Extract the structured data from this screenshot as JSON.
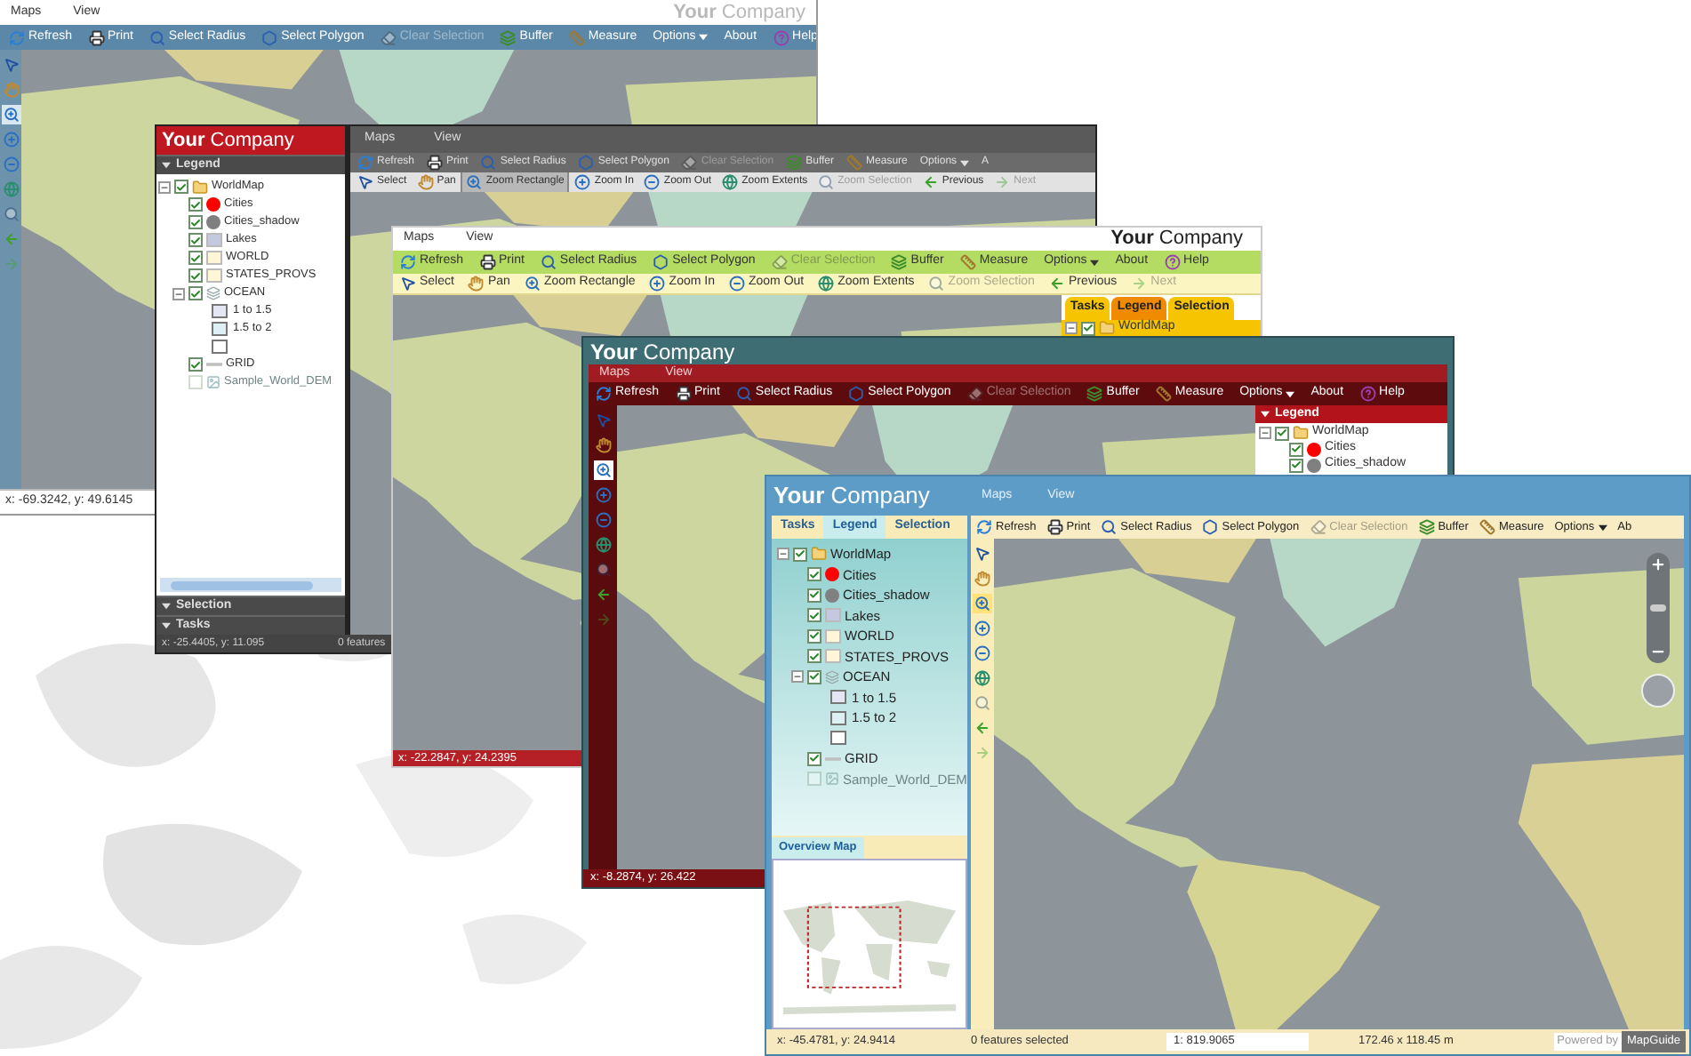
{
  "windows": [
    {
      "kind": "steel",
      "logo": "**Your** Company",
      "menu": [
        "Maps",
        "View"
      ],
      "toolbar": [
        {
          "kind": "refresh",
          "label": "Refresh",
          "disabled": false
        },
        {
          "kind": "print",
          "label": "Print",
          "disabled": false
        },
        {
          "kind": "radius",
          "label": "Select Radius",
          "disabled": false
        },
        {
          "kind": "polygon",
          "label": "Select Polygon",
          "disabled": false
        },
        {
          "kind": "clear",
          "label": "Clear Selection",
          "disabled": true
        },
        {
          "kind": "buffer",
          "label": "Buffer",
          "disabled": false
        },
        {
          "kind": "measure",
          "label": "Measure",
          "disabled": false
        },
        {
          "kind": "options",
          "label": "Options",
          "disabled": false
        },
        {
          "kind": "about",
          "label": "About",
          "disabled": false
        },
        {
          "kind": "help",
          "label": "Help",
          "disabled": false
        }
      ],
      "strip": [
        {
          "kind": "select",
          "selected": false,
          "disabled": false
        },
        {
          "kind": "pan",
          "selected": false,
          "disabled": false
        },
        {
          "kind": "zoomrect",
          "selected": true,
          "disabled": false
        },
        {
          "kind": "zoomin",
          "selected": false,
          "disabled": false
        },
        {
          "kind": "zoomout",
          "selected": false,
          "disabled": false
        },
        {
          "kind": "extents",
          "selected": false,
          "disabled": false
        },
        {
          "kind": "zoomsel",
          "selected": false,
          "disabled": true
        },
        {
          "kind": "previous",
          "selected": false,
          "disabled": false
        },
        {
          "kind": "next",
          "selected": false,
          "disabled": true
        }
      ],
      "status": [
        "x: -69.3242, y: 49.6145"
      ]
    },
    {
      "kind": "graphite",
      "logo": "**Your** Company",
      "menu": [
        "Maps",
        "View"
      ],
      "toolbars": [
        [
          {
            "kind": "refresh",
            "label": "Refresh",
            "disabled": false,
            "selected": false
          },
          {
            "kind": "print",
            "label": "Print",
            "disabled": false,
            "selected": false
          },
          {
            "kind": "radius",
            "label": "Select Radius",
            "disabled": false,
            "selected": false
          },
          {
            "kind": "polygon",
            "label": "Select Polygon",
            "disabled": false,
            "selected": false
          },
          {
            "kind": "clear",
            "label": "Clear Selection",
            "disabled": true,
            "selected": false
          },
          {
            "kind": "buffer",
            "label": "Buffer",
            "disabled": false,
            "selected": false
          },
          {
            "kind": "measure",
            "label": "Measure",
            "disabled": false,
            "selected": false
          },
          {
            "kind": "options",
            "label": "Options",
            "disabled": false,
            "selected": false
          },
          {
            "kind": "about",
            "label": "A",
            "disabled": false,
            "selected": false
          }
        ],
        [
          {
            "kind": "select",
            "label": "Select",
            "disabled": false,
            "selected": false
          },
          {
            "kind": "pan",
            "label": "Pan",
            "disabled": false,
            "selected": false
          },
          {
            "kind": "zoomrect",
            "label": "Zoom Rectangle",
            "disabled": false,
            "selected": true
          },
          {
            "kind": "zoomin",
            "label": "Zoom In",
            "disabled": false,
            "selected": false
          },
          {
            "kind": "zoomout",
            "label": "Zoom Out",
            "disabled": false,
            "selected": false
          },
          {
            "kind": "extents",
            "label": "Zoom Extents",
            "disabled": false,
            "selected": false
          },
          {
            "kind": "zoomsel",
            "label": "Zoom Selection",
            "disabled": true,
            "selected": false
          },
          {
            "kind": "previous",
            "label": "Previous",
            "disabled": false,
            "selected": false
          },
          {
            "kind": "next",
            "label": "Next",
            "disabled": true,
            "selected": false
          }
        ]
      ],
      "sections": [
        {
          "title": "Legend",
          "tree": [
            {
              "label": "WorldMap",
              "kind": "group",
              "checked": true,
              "disabled": false,
              "expanded": true,
              "children": [
                {
                  "label": "Cities",
                  "kind": "point",
                  "color": "#ff0000",
                  "checked": true,
                  "disabled": false
                },
                {
                  "label": "Cities_shadow",
                  "kind": "point",
                  "color": "#808080",
                  "checked": true,
                  "disabled": false
                },
                {
                  "label": "Lakes",
                  "kind": "area",
                  "color": "#c5c9e0",
                  "checked": true,
                  "disabled": false
                },
                {
                  "label": "WORLD",
                  "kind": "area",
                  "color": "#fff6d8",
                  "checked": true,
                  "disabled": false
                },
                {
                  "label": "STATES_PROVS",
                  "kind": "area",
                  "color": "#fff6d8",
                  "checked": true,
                  "disabled": false
                },
                {
                  "label": "OCEAN",
                  "kind": "thematic",
                  "checked": true,
                  "disabled": false,
                  "expanded": true,
                  "classes": [
                    {
                      "label": "1 to 1.5",
                      "color": "#e4e6f4"
                    },
                    {
                      "label": "1.5 to 2",
                      "color": "#def0f4"
                    },
                    {
                      "color": "#ffffff"
                    }
                  ]
                },
                {
                  "label": "GRID",
                  "kind": "line",
                  "color": "#c0c0c0",
                  "checked": true,
                  "disabled": false
                },
                {
                  "label": "Sample_World_DEM",
                  "kind": "raster",
                  "checked": false,
                  "disabled": true
                }
              ]
            }
          ]
        },
        {
          "title": "Selection"
        },
        {
          "title": "Tasks"
        }
      ],
      "status": [
        "x: -25.4405, y: 11.095",
        "0 features"
      ]
    },
    {
      "kind": "lime",
      "logo": "**Your** Company",
      "menu": [
        "Maps",
        "View"
      ],
      "toolbars": [
        [
          {
            "kind": "refresh",
            "label": "Refresh",
            "disabled": false
          },
          {
            "kind": "print",
            "label": "Print",
            "disabled": false
          },
          {
            "kind": "radius",
            "label": "Select Radius",
            "disabled": false
          },
          {
            "kind": "polygon",
            "label": "Select Polygon",
            "disabled": false
          },
          {
            "kind": "clear",
            "label": "Clear Selection",
            "disabled": true
          },
          {
            "kind": "buffer",
            "label": "Buffer",
            "disabled": false
          },
          {
            "kind": "measure",
            "label": "Measure",
            "disabled": false
          },
          {
            "kind": "options",
            "label": "Options",
            "disabled": false
          },
          {
            "kind": "about",
            "label": "About",
            "disabled": false
          },
          {
            "kind": "help",
            "label": "Help",
            "disabled": false
          }
        ],
        [
          {
            "kind": "select",
            "label": "Select",
            "disabled": false
          },
          {
            "kind": "pan",
            "label": "Pan",
            "disabled": false
          },
          {
            "kind": "zoomrect",
            "label": "Zoom Rectangle",
            "disabled": false
          },
          {
            "kind": "zoomin",
            "label": "Zoom In",
            "disabled": false
          },
          {
            "kind": "zoomout",
            "label": "Zoom Out",
            "disabled": false
          },
          {
            "kind": "extents",
            "label": "Zoom Extents",
            "disabled": false
          },
          {
            "kind": "zoomsel",
            "label": "Zoom Selection",
            "disabled": true
          },
          {
            "kind": "previous",
            "label": "Previous",
            "disabled": false
          },
          {
            "kind": "next",
            "label": "Next",
            "disabled": true
          }
        ]
      ],
      "tabs": [
        {
          "label": "Tasks",
          "selected": false
        },
        {
          "label": "Legend",
          "selected": true
        },
        {
          "label": "Selection",
          "selected": false
        }
      ],
      "tree": [
        {
          "label": "WorldMap",
          "kind": "group",
          "checked": true,
          "disabled": false,
          "expanded": true
        }
      ],
      "status": [
        "x: -22.2847, y: 24.2395"
      ]
    },
    {
      "kind": "crimson",
      "logo": "**Your** Company",
      "menu": [
        "Maps",
        "View"
      ],
      "toolbar": [
        {
          "kind": "refresh",
          "label": "Refresh",
          "disabled": false
        },
        {
          "kind": "print",
          "label": "Print",
          "disabled": false
        },
        {
          "kind": "radius",
          "label": "Select Radius",
          "disabled": false
        },
        {
          "kind": "polygon",
          "label": "Select Polygon",
          "disabled": false
        },
        {
          "kind": "clear",
          "label": "Clear Selection",
          "disabled": true
        },
        {
          "kind": "buffer",
          "label": "Buffer",
          "disabled": false
        },
        {
          "kind": "measure",
          "label": "Measure",
          "disabled": false
        },
        {
          "kind": "options",
          "label": "Options",
          "disabled": false
        },
        {
          "kind": "about",
          "label": "About",
          "disabled": false
        },
        {
          "kind": "help",
          "label": "Help",
          "disabled": false
        }
      ],
      "strip": [
        {
          "kind": "select",
          "selected": false,
          "disabled": false
        },
        {
          "kind": "pan",
          "selected": false,
          "disabled": false
        },
        {
          "kind": "zoomrect",
          "selected": true,
          "disabled": false
        },
        {
          "kind": "zoomin",
          "selected": false,
          "disabled": false
        },
        {
          "kind": "zoomout",
          "selected": false,
          "disabled": false
        },
        {
          "kind": "extents",
          "selected": false,
          "disabled": false
        },
        {
          "kind": "zoomsel",
          "selected": false,
          "disabled": true
        },
        {
          "kind": "previous",
          "selected": false,
          "disabled": false
        },
        {
          "kind": "next",
          "selected": false,
          "disabled": true
        }
      ],
      "legend": {
        "title": "Legend",
        "tree": [
          {
            "label": "WorldMap",
            "kind": "group",
            "checked": true,
            "disabled": false,
            "expanded": true,
            "children": [
              {
                "label": "Cities",
                "kind": "point",
                "color": "#ff0000",
                "checked": true,
                "disabled": false
              },
              {
                "label": "Cities_shadow",
                "kind": "point",
                "color": "#808080",
                "checked": true,
                "disabled": false
              }
            ]
          }
        ]
      },
      "status": [
        "x: -8.2874, y: 26.422"
      ]
    },
    {
      "kind": "sky",
      "logo": "**Your** Company",
      "menu": [
        "Maps",
        "View"
      ],
      "tabs": [
        {
          "label": "Tasks",
          "selected": false
        },
        {
          "label": "Legend",
          "selected": true
        },
        {
          "label": "Selection",
          "selected": false
        }
      ],
      "toolbar": [
        {
          "kind": "refresh",
          "label": "Refresh",
          "disabled": false
        },
        {
          "kind": "print",
          "label": "Print",
          "disabled": false
        },
        {
          "kind": "radius",
          "label": "Select Radius",
          "disabled": false
        },
        {
          "kind": "polygon",
          "label": "Select Polygon",
          "disabled": false
        },
        {
          "kind": "clear",
          "label": "Clear Selection",
          "disabled": true
        },
        {
          "kind": "buffer",
          "label": "Buffer",
          "disabled": false
        },
        {
          "kind": "measure",
          "label": "Measure",
          "disabled": false
        },
        {
          "kind": "options",
          "label": "Options",
          "disabled": false
        },
        {
          "kind": "about",
          "label": "Ab",
          "disabled": false
        }
      ],
      "tree": [
        {
          "label": "WorldMap",
          "kind": "group",
          "checked": true,
          "disabled": false,
          "expanded": true,
          "children": [
            {
              "label": "Cities",
              "kind": "point",
              "color": "#ff0000",
              "checked": true,
              "disabled": false
            },
            {
              "label": "Cities_shadow",
              "kind": "point",
              "color": "#808080",
              "checked": true,
              "disabled": false
            },
            {
              "label": "Lakes",
              "kind": "area",
              "color": "#c5c9e0",
              "checked": true,
              "disabled": false
            },
            {
              "label": "WORLD",
              "kind": "area",
              "color": "#fff6d8",
              "checked": true,
              "disabled": false
            },
            {
              "label": "STATES_PROVS",
              "kind": "area",
              "color": "#fff6d8",
              "checked": true,
              "disabled": false
            },
            {
              "label": "OCEAN",
              "kind": "thematic",
              "checked": true,
              "disabled": false,
              "expanded": true,
              "classes": [
                {
                  "label": "1 to 1.5",
                  "color": "#e4e6f4"
                },
                {
                  "label": "1.5 to 2",
                  "color": "#def0f4"
                },
                {
                  "color": "#ffffff"
                }
              ]
            },
            {
              "label": "GRID",
              "kind": "line",
              "color": "#c0c0c0",
              "checked": true,
              "disabled": false
            },
            {
              "label": "Sample_World_DEM",
              "kind": "raster",
              "checked": false,
              "disabled": true
            }
          ]
        }
      ],
      "strip": [
        {
          "kind": "select",
          "selected": false,
          "disabled": false
        },
        {
          "kind": "pan",
          "selected": false,
          "disabled": false
        },
        {
          "kind": "zoomrect",
          "selected": true,
          "disabled": false
        },
        {
          "kind": "zoomin",
          "selected": false,
          "disabled": false
        },
        {
          "kind": "zoomout",
          "selected": false,
          "disabled": false
        },
        {
          "kind": "extents",
          "selected": false,
          "disabled": false
        },
        {
          "kind": "zoomsel",
          "selected": false,
          "disabled": true
        },
        {
          "kind": "previous",
          "selected": false,
          "disabled": false
        },
        {
          "kind": "next",
          "selected": false,
          "disabled": true
        }
      ],
      "zoom_slider": {
        "level": 0.5
      },
      "overview_tab": "Overview Map",
      "status": [
        "x: -45.4781, y: 24.9414",
        "0 features selected",
        "1: 819.9065",
        "172.46 x 118.45 m"
      ],
      "powered_by": "Powered by",
      "brand": "MapGuide"
    }
  ]
}
